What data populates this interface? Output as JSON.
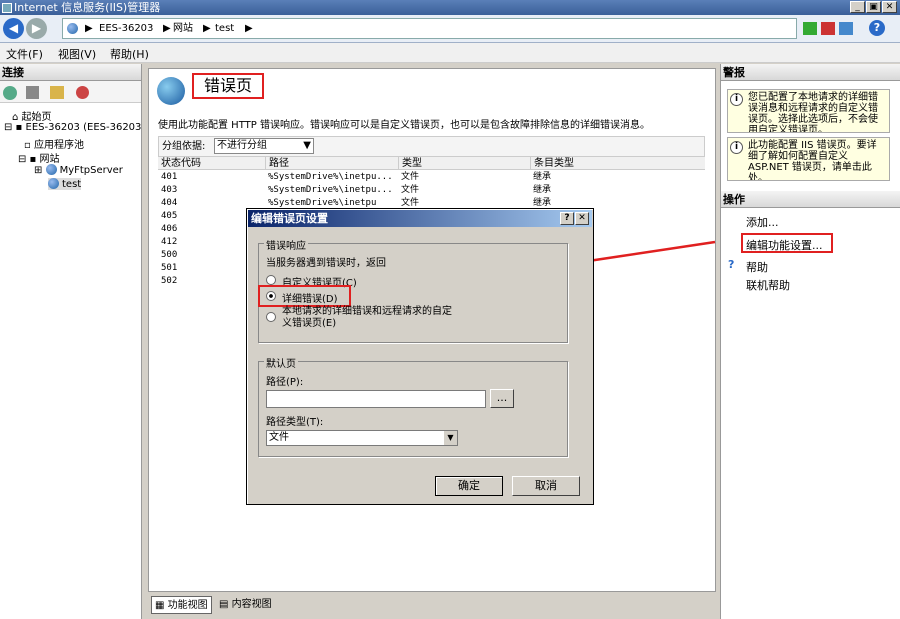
{
  "window": {
    "title": "Internet 信息服务(IIS)管理器",
    "min": "_",
    "max": "▣",
    "close": "✕"
  },
  "address": {
    "crumbs": [
      "EES-36203",
      "网站",
      "test"
    ],
    "help": "?"
  },
  "menu": [
    "文件(F)",
    "视图(V)",
    "帮助(H)"
  ],
  "connections": {
    "title": "连接",
    "tree": [
      "起始页",
      "EES-36203 (EES-36203",
      "应用程序池",
      "网站",
      "MyFtpServer",
      "test"
    ]
  },
  "page": {
    "title": "错误页",
    "description": "使用此功能配置 HTTP 错误响应。错误响应可以是自定义错误页，也可以是包含故障排除信息的详细错误消息。",
    "groupby_label": "分组依据:",
    "groupby_value": "不进行分组"
  },
  "grid": {
    "columns": [
      "状态代码",
      "路径",
      "类型",
      "条目类型"
    ],
    "rows": [
      {
        "code": "401",
        "path": "%SystemDrive%\\inetpu...",
        "type": "文件",
        "entry": "继承"
      },
      {
        "code": "403",
        "path": "%SystemDrive%\\inetpu...",
        "type": "文件",
        "entry": "继承"
      },
      {
        "code": "404",
        "path": "%SystemDrive%\\inetpu",
        "type": "文件",
        "entry": "继承"
      },
      {
        "code": "405",
        "path": "",
        "type": "",
        "entry": ""
      },
      {
        "code": "406",
        "path": "",
        "type": "",
        "entry": ""
      },
      {
        "code": "412",
        "path": "",
        "type": "",
        "entry": ""
      },
      {
        "code": "500",
        "path": "",
        "type": "",
        "entry": ""
      },
      {
        "code": "501",
        "path": "",
        "type": "",
        "entry": ""
      },
      {
        "code": "502",
        "path": "",
        "type": "",
        "entry": ""
      }
    ]
  },
  "tabs": [
    "功能视图",
    "内容视图"
  ],
  "alerts": {
    "title": "警报",
    "a1": "您已配置了本地请求的详细错误消息和远程请求的自定义错误页。选择此选项后，不会使用自定义错误页。",
    "a2": "此功能配置 IIS 错误页。要详细了解如何配置自定义 ASP.NET 错误页，请单击此处。"
  },
  "actions": {
    "title": "操作",
    "add": "添加...",
    "edit": "编辑功能设置...",
    "help": "帮助",
    "online": "联机帮助"
  },
  "dialog": {
    "title": "编辑错误页设置",
    "group1": "错误响应",
    "prompt": "当服务器遇到错误时，返回",
    "opt1": "自定义错误页(C)",
    "opt2": "详细错误(D)",
    "opt3": "本地请求的详细错误和远程请求的自定义错误页(E)",
    "group2": "默认页",
    "path_label": "路径(P):",
    "path_value": "",
    "browse": "...",
    "ptype_label": "路径类型(T):",
    "ptype_value": "文件",
    "ok": "确定",
    "cancel": "取消"
  }
}
